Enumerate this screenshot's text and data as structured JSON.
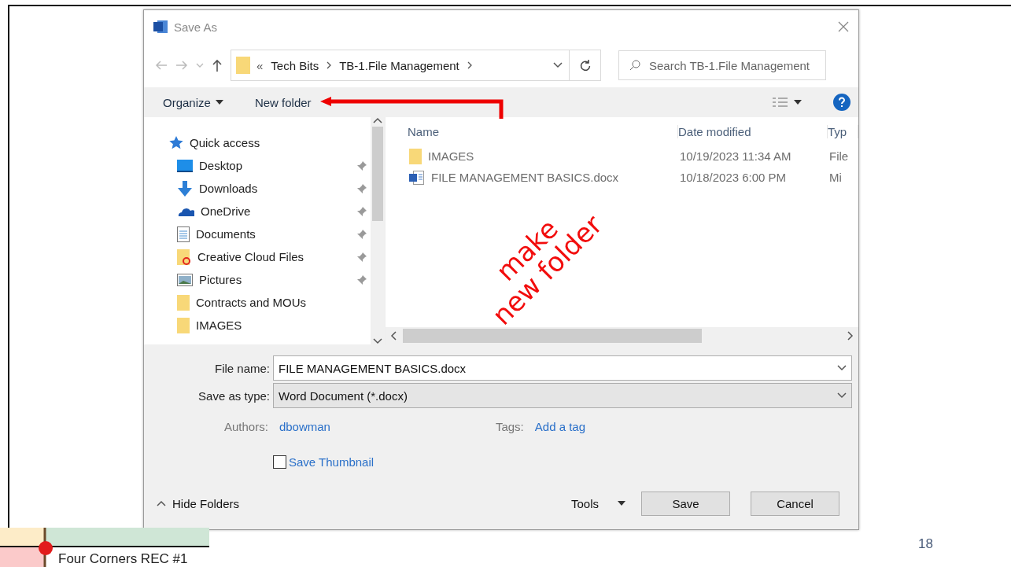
{
  "dialog": {
    "title": "Save As",
    "address": {
      "overflow": "«",
      "crumbs": [
        "Tech Bits",
        "TB-1.File Management"
      ]
    },
    "search": {
      "placeholder": "Search TB-1.File Management"
    },
    "toolbar": {
      "organize": "Organize",
      "new_folder": "New folder"
    },
    "nav_pane": {
      "items": [
        {
          "label": "Quick access",
          "kind": "star",
          "pinned": false
        },
        {
          "label": "Desktop",
          "kind": "desktop",
          "pinned": true
        },
        {
          "label": "Downloads",
          "kind": "download",
          "pinned": true
        },
        {
          "label": "OneDrive",
          "kind": "cloud",
          "pinned": true
        },
        {
          "label": "Documents",
          "kind": "document",
          "pinned": true
        },
        {
          "label": "Creative Cloud Files",
          "kind": "cc-folder",
          "pinned": true
        },
        {
          "label": "Pictures",
          "kind": "pictures",
          "pinned": true
        },
        {
          "label": "Contracts and MOUs",
          "kind": "folder",
          "pinned": false
        },
        {
          "label": "IMAGES",
          "kind": "folder",
          "pinned": false
        }
      ]
    },
    "file_list": {
      "columns": [
        "Name",
        "Date modified",
        "Typ"
      ],
      "rows": [
        {
          "name": "IMAGES",
          "kind": "folder",
          "date": "10/19/2023 11:34 AM",
          "type": "File"
        },
        {
          "name": "FILE MANAGEMENT BASICS.docx",
          "kind": "word",
          "date": "10/18/2023 6:00 PM",
          "type": "Mi"
        }
      ]
    },
    "form": {
      "file_name": {
        "label": "File name:",
        "value": "FILE MANAGEMENT BASICS.docx"
      },
      "save_type": {
        "label": "Save as type:",
        "value": "Word Document (*.docx)"
      },
      "authors": {
        "label": "Authors:",
        "value": "dbowman"
      },
      "tags": {
        "label": "Tags:",
        "value": "Add a tag"
      },
      "thumbnail": {
        "label": "Save Thumbnail",
        "checked": false
      }
    },
    "footer": {
      "hide_folders": "Hide Folders",
      "tools": "Tools",
      "save": "Save",
      "cancel": "Cancel"
    }
  },
  "annotation": {
    "lines": [
      "make",
      "new folder"
    ]
  },
  "slide": {
    "footer": "Four Corners REC #1",
    "page_number": "18"
  }
}
